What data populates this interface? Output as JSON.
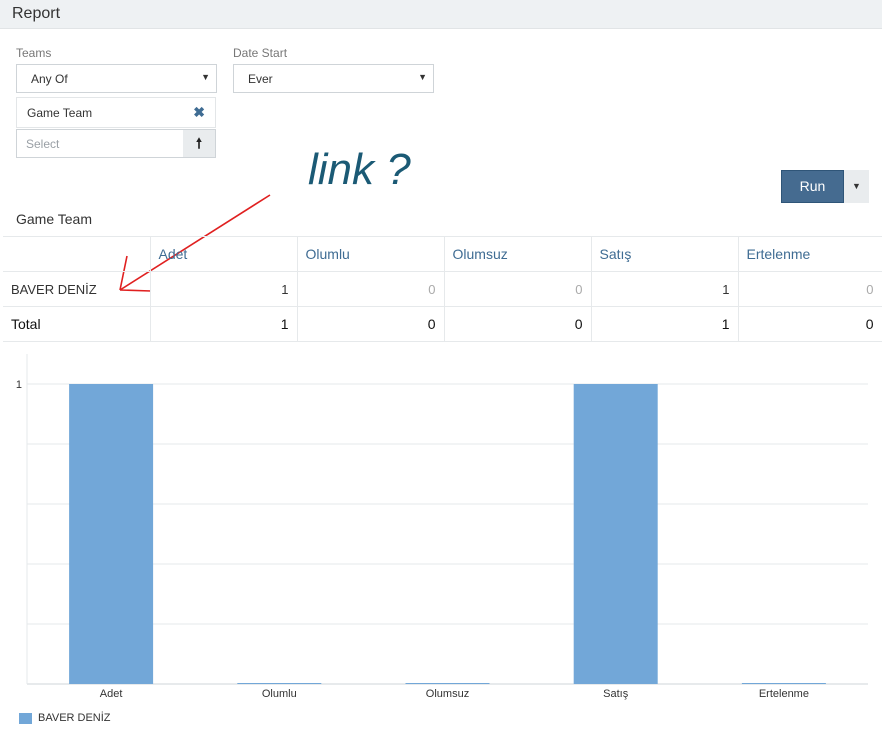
{
  "header": {
    "title": "Report"
  },
  "filters": {
    "teams_label": "Teams",
    "teams_value": "Any Of",
    "date_label": "Date Start",
    "date_value": "Ever",
    "selected_team": "Game Team",
    "select_placeholder": "Select"
  },
  "annotation": {
    "text": "link ?"
  },
  "run_button": {
    "label": "Run"
  },
  "section": {
    "title": "Game Team"
  },
  "table": {
    "columns": [
      "Adet",
      "Olumlu",
      "Olumsuz",
      "Satış",
      "Ertelenme"
    ],
    "rows": [
      {
        "name": "BAVER DENİZ",
        "values": [
          "1",
          "0",
          "0",
          "1",
          "0"
        ]
      }
    ],
    "total": {
      "name": "Total",
      "values": [
        "1",
        "0",
        "0",
        "1",
        "0"
      ]
    }
  },
  "chart_data": {
    "type": "bar",
    "categories": [
      "Adet",
      "Olumlu",
      "Olumsuz",
      "Satış",
      "Ertelenme"
    ],
    "series": [
      {
        "name": "BAVER DENİZ",
        "values": [
          1,
          0,
          0,
          1,
          0
        ]
      }
    ],
    "ylim": [
      0,
      1
    ],
    "yticks": [
      "1"
    ],
    "grid": true,
    "legend": "bottom-left",
    "color": "#72a7d8"
  }
}
